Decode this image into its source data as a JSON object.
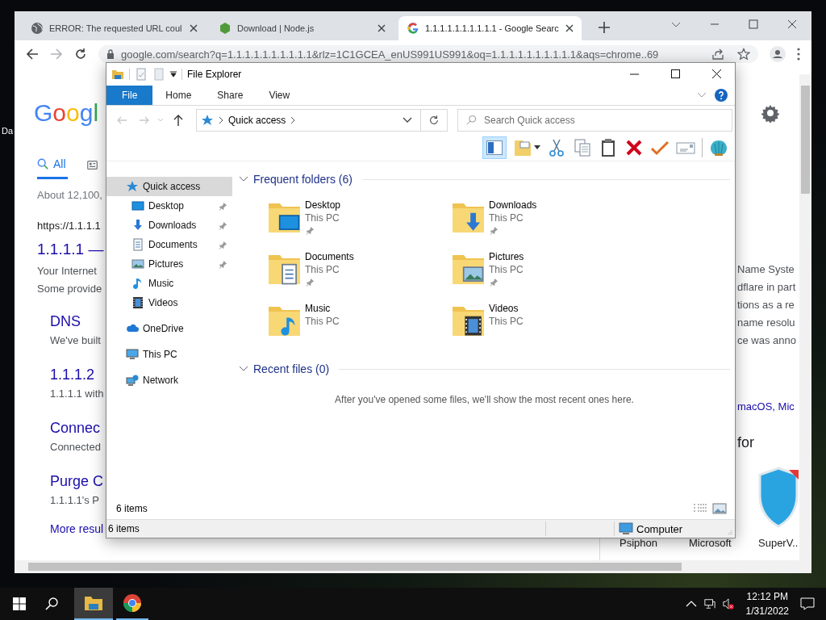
{
  "desktop": {
    "icon_label": "Da"
  },
  "browser": {
    "tabs": [
      {
        "title": "ERROR: The requested URL coul",
        "kind": "globe",
        "selected": false
      },
      {
        "title": "Download | Node.js",
        "kind": "hexagon",
        "selected": false
      },
      {
        "title": "1.1.1.1.1.1.1.1.1.1 - Google Searc",
        "kind": "g",
        "selected": true
      }
    ],
    "address": "google.com/search?q=1.1.1.1.1.1.1.1.1.1&rlz=1C1GCEA_enUS991US991&oq=1.1.1.1.1.1.1.1.1.1&aqs=chrome..69",
    "page": {
      "logo": "Googl",
      "search_tabs": [
        {
          "label": "All",
          "selected": true
        }
      ],
      "result_stats": "About 12,100,",
      "results": [
        {
          "kind": "url",
          "text": "https://1.1.1.1"
        },
        {
          "kind": "title",
          "text": "1.1.1.1 —"
        },
        {
          "kind": "snippet",
          "text": "Your Internet"
        },
        {
          "kind": "snippet",
          "text": "Some provide"
        },
        {
          "kind": "sublink",
          "text": "DNS"
        },
        {
          "kind": "subsnippet",
          "text": "We've built"
        },
        {
          "kind": "sublink",
          "text": "1.1.1.2"
        },
        {
          "kind": "subsnippet",
          "text": "1.1.1.1 with"
        },
        {
          "kind": "sublink",
          "text": "Connec"
        },
        {
          "kind": "subsnippet",
          "text": "Connected"
        },
        {
          "kind": "sublink",
          "text": "Purge C"
        },
        {
          "kind": "subsnippet",
          "text": "1.1.1.1's P"
        },
        {
          "kind": "more",
          "text": "More resul"
        }
      ],
      "panel_lines": [
        "Name Syste",
        "dflare in part",
        "tions as a re",
        "name resolu",
        "ce was anno"
      ],
      "panel_link": "macOS, Mic",
      "panel_heading": "for",
      "apps": [
        "Psiphon",
        "Microsoft",
        "SuperV.."
      ]
    }
  },
  "explorer": {
    "title": "File Explorer",
    "ribbon_tabs": [
      {
        "label": "File",
        "selected": true
      },
      {
        "label": "Home",
        "selected": false
      },
      {
        "label": "Share",
        "selected": false
      },
      {
        "label": "View",
        "selected": false
      }
    ],
    "location": "Quick access",
    "search": {
      "placeholder": "Search Quick access"
    },
    "preview_pane": {
      "on": true
    },
    "nav": [
      {
        "label": "Quick access",
        "kind": "quickaccess",
        "selected": true,
        "children": [
          {
            "label": "Desktop",
            "kind": "desktop",
            "pinned": true,
            "selected": false
          },
          {
            "label": "Downloads",
            "kind": "downloads",
            "pinned": true,
            "selected": false
          },
          {
            "label": "Documents",
            "kind": "documents",
            "pinned": true,
            "selected": false
          },
          {
            "label": "Pictures",
            "kind": "pictures",
            "pinned": true,
            "selected": false
          },
          {
            "label": "Music",
            "kind": "music",
            "pinned": false,
            "selected": false
          },
          {
            "label": "Videos",
            "kind": "videos",
            "pinned": false,
            "selected": false
          }
        ]
      },
      {
        "label": "OneDrive",
        "kind": "onedrive",
        "selected": false
      },
      {
        "label": "This PC",
        "kind": "pc",
        "selected": false
      },
      {
        "label": "Network",
        "kind": "network",
        "selected": false
      }
    ],
    "frequent": {
      "title": "Frequent folders (6)",
      "expanded": true,
      "folders": [
        {
          "name": "Desktop",
          "location": "This PC",
          "kind": "desktop",
          "pinned": true
        },
        {
          "name": "Downloads",
          "location": "This PC",
          "kind": "downloads",
          "pinned": true
        },
        {
          "name": "Documents",
          "location": "This PC",
          "kind": "documents",
          "pinned": true
        },
        {
          "name": "Pictures",
          "location": "This PC",
          "kind": "pictures",
          "pinned": true
        },
        {
          "name": "Music",
          "location": "This PC",
          "kind": "music",
          "pinned": false
        },
        {
          "name": "Videos",
          "location": "This PC",
          "kind": "videos",
          "pinned": false
        }
      ]
    },
    "recent": {
      "title": "Recent files (0)",
      "expanded": true,
      "message": "After you've opened some files, we'll show the most recent ones here."
    },
    "item_count": "6 items",
    "status_bar": {
      "count": "6 items",
      "zone": "Computer"
    }
  },
  "taskbar": {
    "apps": [
      {
        "kind": "explorer",
        "active": true
      },
      {
        "kind": "chrome",
        "active": false
      }
    ],
    "time": "12:12 PM",
    "date": "1/31/2022",
    "volume_muted": true
  }
}
